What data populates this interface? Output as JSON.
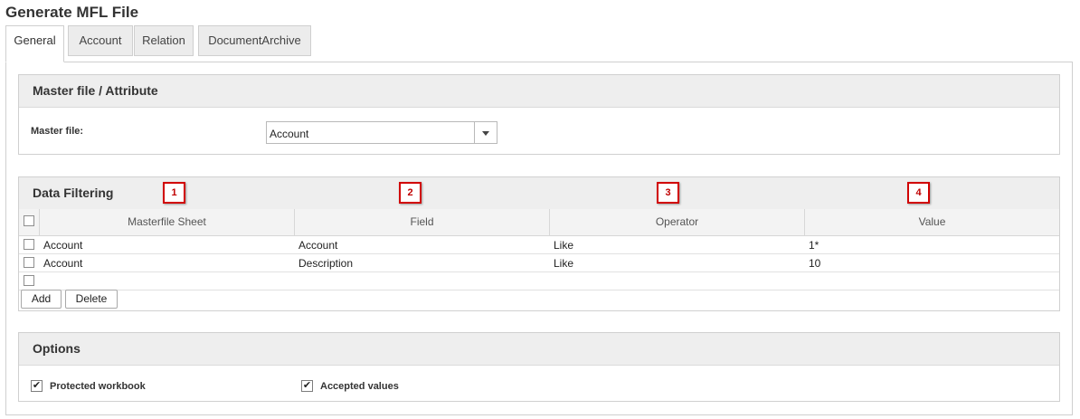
{
  "page": {
    "title": "Generate MFL File"
  },
  "tabs": [
    {
      "label": "General",
      "active": true
    },
    {
      "label": "Account",
      "active": false
    },
    {
      "label": "Relation",
      "active": false
    },
    {
      "label": "DocumentArchive",
      "active": false
    }
  ],
  "master_file_section": {
    "title": "Master file / Attribute",
    "field_label": "Master file:",
    "selected_value": "Account"
  },
  "data_filtering": {
    "title": "Data Filtering",
    "markers": [
      "1",
      "2",
      "3",
      "4"
    ],
    "columns": [
      "Masterfile Sheet",
      "Field",
      "Operator",
      "Value"
    ],
    "rows": [
      {
        "sheet": "Account",
        "field": "Account",
        "operator": "Like",
        "value": "1*"
      },
      {
        "sheet": "Account",
        "field": "Description",
        "operator": "Like",
        "value": "10"
      }
    ],
    "add_label": "Add",
    "delete_label": "Delete"
  },
  "options": {
    "title": "Options",
    "protected_workbook": {
      "label": "Protected workbook",
      "checked": true
    },
    "accepted_values": {
      "label": "Accepted values",
      "checked": true
    }
  },
  "colors": {
    "marker_border": "#d10000",
    "header_bg": "#eeeeee"
  }
}
